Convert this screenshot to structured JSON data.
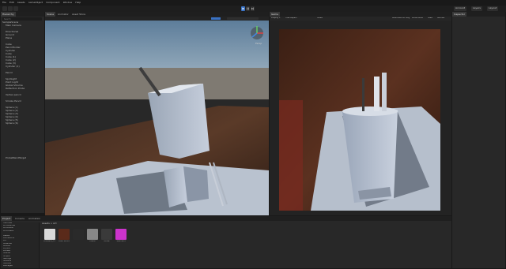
{
  "menubar": {
    "items": [
      "File",
      "Edit",
      "Assets",
      "GameObject",
      "Component",
      "Window",
      "Help"
    ]
  },
  "toolbar": {
    "account_label": "Account",
    "layers_label": "Layers",
    "layout_label": "Layout"
  },
  "hierarchy": {
    "tab_label": "Hierarchy",
    "search_placeholder": "Search",
    "rows": [
      "SampleScene",
      "Main Camera",
      "",
      "Directional",
      "Ground",
      "Plane",
      "",
      "Cube",
      "PencilHolder",
      "Cylinder",
      "Cube",
      "Cube (1)",
      "Cube (2)",
      "Cube (3)",
      "Cylinder (1)",
      "",
      "Pencil",
      "",
      "SpotLight",
      "Point Light",
      "Global Volume",
      "Reflection Probe",
      "",
      "Vertex pencil",
      "",
      "Smoke Pencil",
      "",
      "Sphere (1)",
      "Sphere (2)",
      "Sphere (3)",
      "Sphere (4)",
      "Sphere (5)",
      "Sphere (6)",
      "",
      "",
      "",
      "",
      "",
      "",
      "",
      "",
      "",
      "",
      "ProbeBlendTarget"
    ]
  },
  "scene": {
    "tabs": [
      "Scene",
      "Animator",
      "Asset Store"
    ],
    "persp_label": "Persp"
  },
  "game": {
    "tabs": [
      "Game"
    ],
    "display_label": "Display 1",
    "resolution_label": "Free Aspect",
    "scale_label": "Scale",
    "maximize_label": "Maximize On Play",
    "mute_label": "Mute Audio",
    "stats_label": "Stats",
    "gizmos_label": "Gizmos"
  },
  "inspector": {
    "tab_label": "Inspector"
  },
  "project": {
    "tabs": [
      "Project",
      "Console",
      "Animation"
    ],
    "breadcrumb": "Assets > Art",
    "tree": [
      "Favorites",
      "All Materials",
      "All Models",
      "All Prefabs",
      "",
      "Assets",
      "Animations",
      "Art",
      "Materials",
      "Models",
      "Physics",
      "Prefabs",
      "Scenes",
      "Scripts",
      "Settings",
      "Shaders",
      "Textures",
      "Packages"
    ],
    "assets": [
      {
        "label": "Ambient_o...",
        "color": "#d8d8d8"
      },
      {
        "label": "Dark Wood",
        "color": "#5a2a1a"
      },
      {
        "label": "",
        "color": "#2a2a2a"
      },
      {
        "label": "Metal",
        "color": "#888888"
      },
      {
        "label": "Noise",
        "color": "#3a3a3a"
      },
      {
        "label": "Standard",
        "color": "#cc33cc"
      }
    ]
  },
  "colors": {
    "accent": "#3a72c4",
    "play_active": "#3a72c4",
    "sky": "#8fb0cf",
    "floor": "#4a3427"
  }
}
